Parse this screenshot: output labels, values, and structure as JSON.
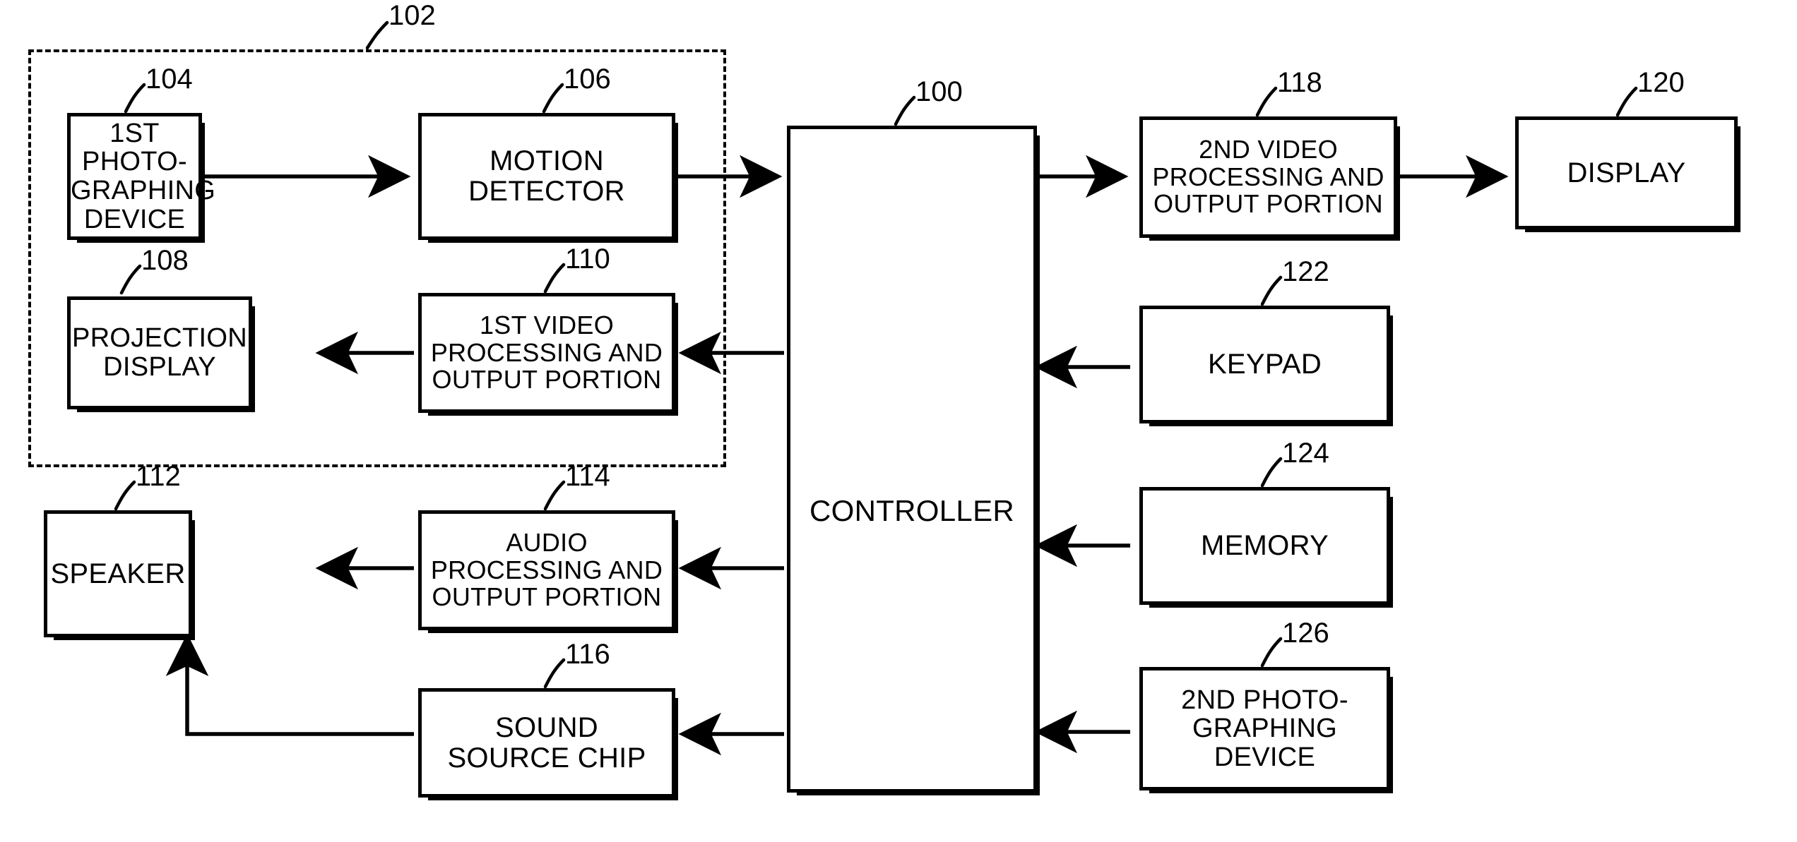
{
  "figure": {
    "type": "patent-block-diagram",
    "background": "#ffffff",
    "ink": "#000000"
  },
  "enclosure": {
    "label": "102",
    "style": "dashed"
  },
  "blocks": [
    {
      "id": "b104",
      "ref": "104",
      "lines": [
        "1ST PHOTO-",
        "GRAPHING",
        "DEVICE"
      ]
    },
    {
      "id": "b106",
      "ref": "106",
      "lines": [
        "MOTION",
        "DETECTOR"
      ]
    },
    {
      "id": "b108",
      "ref": "108",
      "lines": [
        "PROJECTION",
        "DISPLAY"
      ]
    },
    {
      "id": "b110",
      "ref": "110",
      "lines": [
        "1ST VIDEO",
        "PROCESSING AND",
        "OUTPUT PORTION"
      ]
    },
    {
      "id": "b100",
      "ref": "100",
      "lines": [
        "CONTROLLER"
      ]
    },
    {
      "id": "b118",
      "ref": "118",
      "lines": [
        "2ND VIDEO",
        "PROCESSING AND",
        "OUTPUT PORTION"
      ]
    },
    {
      "id": "b120",
      "ref": "120",
      "lines": [
        "DISPLAY"
      ]
    },
    {
      "id": "b122",
      "ref": "122",
      "lines": [
        "KEYPAD"
      ]
    },
    {
      "id": "b124",
      "ref": "124",
      "lines": [
        "MEMORY"
      ]
    },
    {
      "id": "b126",
      "ref": "126",
      "lines": [
        "2ND PHOTO-",
        "GRAPHING",
        "DEVICE"
      ]
    },
    {
      "id": "b112",
      "ref": "112",
      "lines": [
        "SPEAKER"
      ]
    },
    {
      "id": "b114",
      "ref": "114",
      "lines": [
        "AUDIO",
        "PROCESSING AND",
        "OUTPUT PORTION"
      ]
    },
    {
      "id": "b116",
      "ref": "116",
      "lines": [
        "SOUND",
        "SOURCE CHIP"
      ]
    }
  ],
  "connections": [
    {
      "from": "104",
      "to": "106",
      "direction": "right"
    },
    {
      "from": "106",
      "to": "100",
      "direction": "right"
    },
    {
      "from": "100",
      "to": "110",
      "direction": "left"
    },
    {
      "from": "110",
      "to": "108",
      "direction": "left"
    },
    {
      "from": "100",
      "to": "118",
      "direction": "right"
    },
    {
      "from": "118",
      "to": "120",
      "direction": "right"
    },
    {
      "from": "122",
      "to": "100",
      "direction": "left"
    },
    {
      "from": "124",
      "to": "100",
      "direction": "left"
    },
    {
      "from": "126",
      "to": "100",
      "direction": "left"
    },
    {
      "from": "100",
      "to": "114",
      "direction": "left"
    },
    {
      "from": "114",
      "to": "112",
      "direction": "left"
    },
    {
      "from": "100",
      "to": "116",
      "direction": "left"
    },
    {
      "from": "116",
      "to": "112",
      "direction": "up"
    }
  ]
}
